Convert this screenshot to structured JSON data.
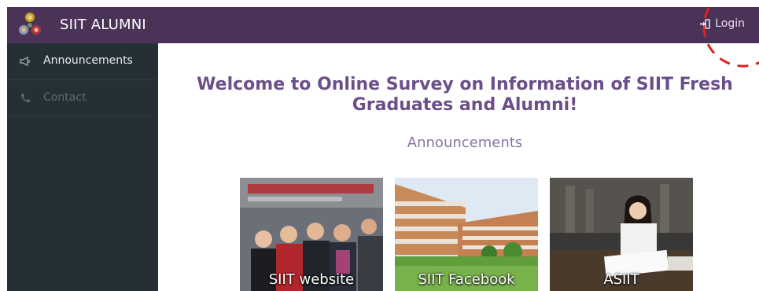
{
  "navbar": {
    "brand_title": "SIIT ALUMNI",
    "login_label": "Login",
    "bg_color": "#4b3358"
  },
  "sidebar": {
    "items": [
      {
        "label": "Announcements",
        "icon": "megaphone-icon",
        "active": true
      },
      {
        "label": "Contact",
        "icon": "phone-icon",
        "active": false
      }
    ]
  },
  "main": {
    "welcome_line1": "Welcome to Online Survey on Information of SIIT Fresh",
    "welcome_line2": "Graduates and Alumni!",
    "subheading": "Announcements",
    "cards": [
      {
        "caption": "SIIT website"
      },
      {
        "caption": "SIIT Facebook"
      },
      {
        "caption": "ASIIT"
      }
    ]
  }
}
